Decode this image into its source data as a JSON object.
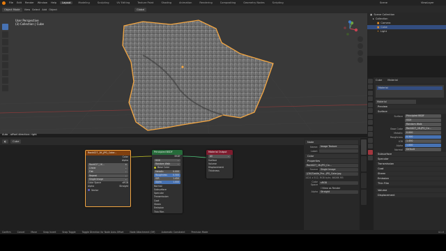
{
  "topbar": {
    "menus": [
      "File",
      "Edit",
      "Render",
      "Window",
      "Help"
    ],
    "workspaces": [
      "Layout",
      "Modeling",
      "Sculpting",
      "UV Editing",
      "Texture Paint",
      "Shading",
      "Animation",
      "Rendering",
      "Compositing",
      "Geometry Nodes",
      "Scripting"
    ],
    "active_workspace": "Layout",
    "scene": "Scene",
    "view_layer": "ViewLayer"
  },
  "viewport": {
    "mode": "Object Mode",
    "menus": [
      "View",
      "Select",
      "Add",
      "Object"
    ],
    "orientation": "Global",
    "options": "Options",
    "info_line1": "User Perspective",
    "info_line2": "(3) Collection | Cube",
    "operator_status": "Auto - offset direction: right"
  },
  "node_editor": {
    "header_item": "Cube",
    "breadcrumb": [
      "Cube",
      "Cube",
      "Material"
    ],
    "image_node": {
      "title": "Rock027_1K_JPG_Color...",
      "image": "Rock027_1K...",
      "interpolation": "Linear",
      "projection": "Flat",
      "extension": "Repeat",
      "source": "Single Image",
      "color_space_label": "Color Space",
      "color_space": "sRGB",
      "alpha_label": "Alpha",
      "alpha": "Straight",
      "vector": "Vector",
      "out_color": "Color",
      "out_alpha": "Alpha"
    },
    "bsdf_node": {
      "title": "Principled BSDF",
      "bsdf_out": "BSDF",
      "distribution": "GGX",
      "subsurface_method": "Random Walk",
      "base_color": "Base Color",
      "fields": [
        {
          "label": "Metallic",
          "value": "0.000"
        },
        {
          "label": "Roughness",
          "value": "0.500"
        },
        {
          "label": "IOR",
          "value": "1.450"
        },
        {
          "label": "Alpha",
          "value": "1.000"
        }
      ],
      "normal": "Normal",
      "panels": [
        "Subsurface",
        "Specular",
        "Transmission",
        "Coat",
        "Sheen",
        "Emission",
        "Thin Film"
      ]
    },
    "output_node": {
      "title": "Material Output",
      "target": "All",
      "inputs": [
        "Surface",
        "Volume",
        "Displacement",
        "Thickness"
      ]
    }
  },
  "n_panel": {
    "section_node": "Node",
    "name_label": "Name:",
    "name_value": "Image Texture",
    "label_label": "Label:",
    "color_section": "Color",
    "properties_section": "Properties",
    "image_value": "Rock027_1K-JPG_Co...",
    "source_label": "Source",
    "source_value": "Single Image",
    "filepath": "//1K/Castle_Pro...JPG_Color.jpg",
    "resolution": "1024 x 512, RGB byte, 6608K RB",
    "color_space_label": "Color Space",
    "color_space_value": "sRGB",
    "view_as_render": "View as Render",
    "alpha_label": "Alpha",
    "alpha_value": "Straight",
    "vtabs": [
      "Node",
      "Tool",
      "View",
      "Options"
    ]
  },
  "outliner": {
    "title": "Scene Collection",
    "items": [
      {
        "name": "Collection",
        "level": 1
      },
      {
        "name": "Camera",
        "level": 2
      },
      {
        "name": "Cube",
        "level": 2,
        "selected": true
      },
      {
        "name": "Light",
        "level": 2
      }
    ]
  },
  "properties": {
    "object": "Cube",
    "tab": "Material",
    "slot": "Material",
    "material_name": "Material",
    "preview": "Preview",
    "surface_panel": "Surface",
    "surface_label": "Surface",
    "surface_value": "Principled BSDF",
    "distribution": "GGX",
    "subsurface_method": "Random Walk",
    "base_color_label": "Base Color",
    "base_color_value": "Rock027_1K-JPG_Co...",
    "fields": [
      {
        "label": "Metallic",
        "value": "0.000"
      },
      {
        "label": "Roughness",
        "value": "0.500"
      },
      {
        "label": "IOR",
        "value": "1.450"
      },
      {
        "label": "Alpha",
        "value": "1.000"
      }
    ],
    "normal_label": "Normal",
    "normal_value": "Default",
    "panels": [
      "Subsurface",
      "Specular",
      "Transmission",
      "Coat",
      "Sheen",
      "Emission",
      "Thin Film"
    ],
    "bottom_panels": [
      "Volume",
      "Displacement"
    ]
  },
  "statusbar": {
    "items": [
      "Confirm",
      "Cancel",
      "Move",
      "Snap Invert",
      "Snap Toggle",
      "Toggle Direction for Node Auto-Offset",
      "Node Attachment (Off)",
      "Automatic Constraint",
      "Precision Mode"
    ],
    "version": "4.1.0"
  },
  "colors": {
    "accent_blue": "#4772b3",
    "selection_orange": "#f5a742",
    "image_node_header": "#7f3f0f",
    "bsdf_node_header": "#266b3a",
    "output_node_header": "#7e1c2e"
  }
}
